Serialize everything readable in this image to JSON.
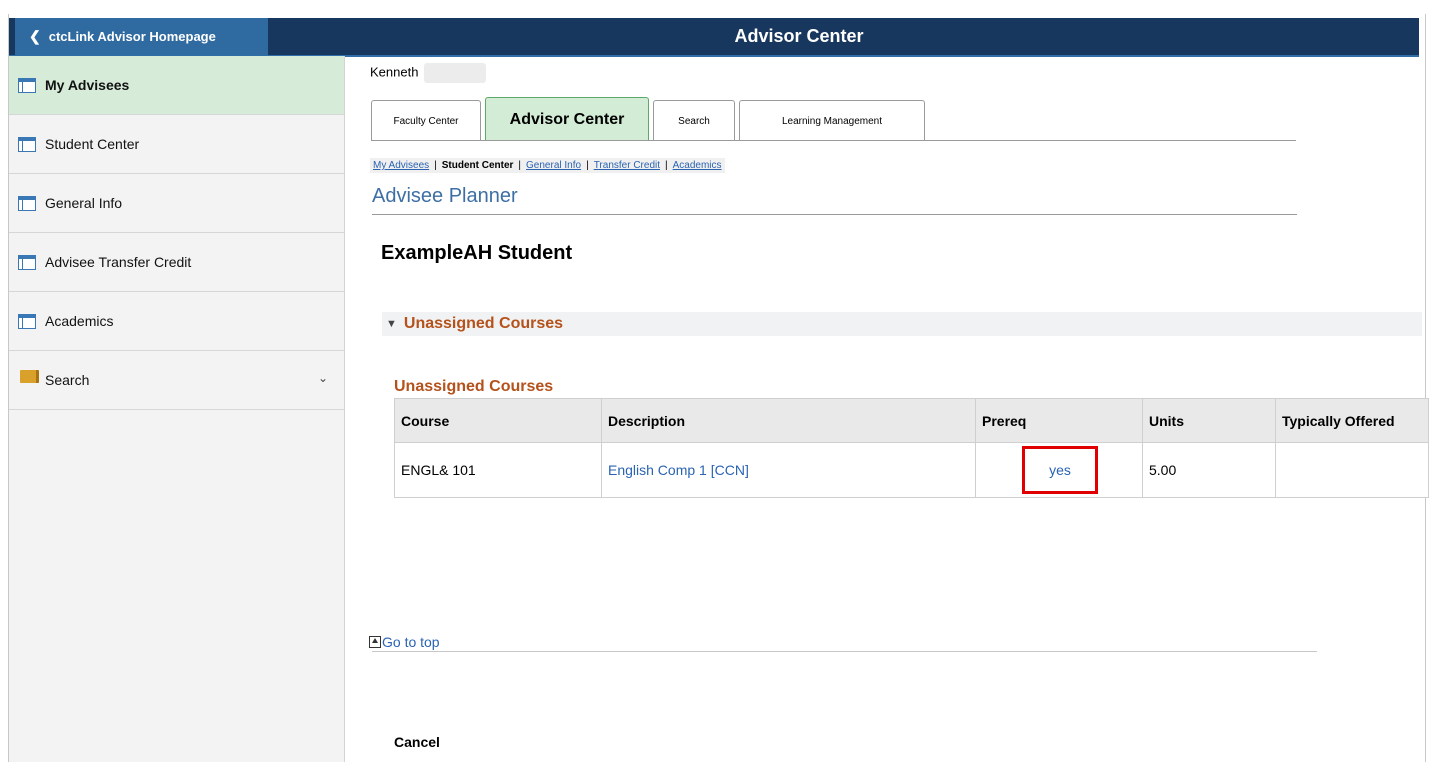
{
  "banner": {
    "home_label": "ctcLink Advisor Homepage",
    "title": "Advisor Center"
  },
  "sidebar": {
    "items": [
      {
        "label": "My Advisees",
        "icon": "table-icon"
      },
      {
        "label": "Student Center",
        "icon": "table-icon"
      },
      {
        "label": "General Info",
        "icon": "table-icon"
      },
      {
        "label": "Advisee Transfer Credit",
        "icon": "table-icon"
      },
      {
        "label": "Academics",
        "icon": "table-icon"
      },
      {
        "label": "Search",
        "icon": "folder-icon"
      }
    ]
  },
  "user": {
    "name": "Kenneth"
  },
  "tabs": [
    "Faculty Center",
    "Advisor Center",
    "Search",
    "Learning Management"
  ],
  "breadcrumbs": {
    "items": [
      "My Advisees",
      "Student Center",
      "General Info",
      "Transfer Credit",
      "Academics"
    ],
    "separator": "|"
  },
  "page": {
    "title": "Advisee Planner",
    "student": "ExampleAH Student",
    "section_header": "Unassigned Courses",
    "grid_title": "Unassigned Courses",
    "go_to_top": "Go to top",
    "cancel": "Cancel"
  },
  "grid": {
    "columns": [
      "Course",
      "Description",
      "Prereq",
      "Units",
      "Typically Offered"
    ],
    "rows": [
      {
        "course": "ENGL& 101",
        "description": "English Comp 1 [CCN]",
        "prereq": "yes",
        "units": "5.00",
        "offered": ""
      }
    ]
  },
  "colors": {
    "banner": "#17375e",
    "home_button": "#2f6aa0",
    "active_green": "#d6ecd9",
    "section_orange": "#b5521b",
    "link_blue": "#2a63b2",
    "highlight_red": "#e00000"
  }
}
